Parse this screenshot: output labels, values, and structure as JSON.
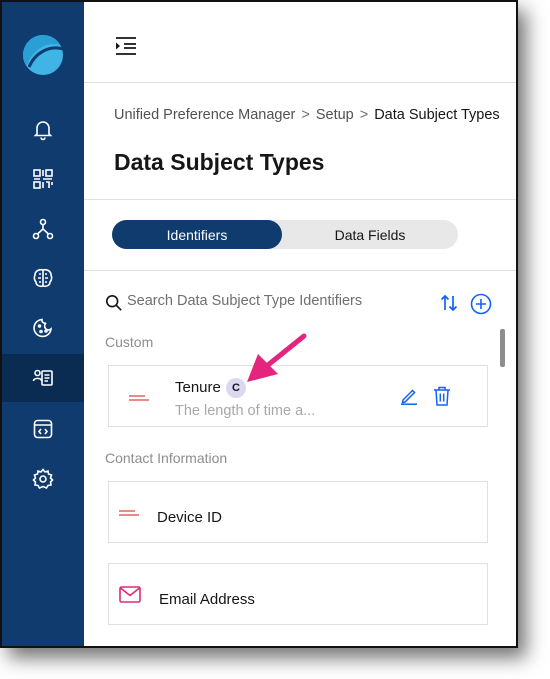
{
  "colors": {
    "sidebar": "#0f3b6e",
    "accent": "#0f62fe",
    "annotation": "#e5247d",
    "icon_red": "#e0443b",
    "icon_pink": "#e0287a"
  },
  "sidebar": {
    "logo": "app-logo",
    "items": [
      {
        "icon": "bell-icon",
        "name": "notifications"
      },
      {
        "icon": "qr-code-icon",
        "name": "data-discovery"
      },
      {
        "icon": "network-icon",
        "name": "data-mapping"
      },
      {
        "icon": "brain-icon",
        "name": "intelligence"
      },
      {
        "icon": "cookie-icon",
        "name": "cookie-consent"
      },
      {
        "icon": "user-list-icon",
        "name": "preference-manager",
        "active": true
      },
      {
        "icon": "code-window-icon",
        "name": "developer"
      },
      {
        "icon": "settings-icon",
        "name": "settings"
      }
    ]
  },
  "topbar": {
    "menu_icon": "collapse-menu-icon"
  },
  "breadcrumb": [
    "Unified Preference Manager",
    "Setup",
    "Data Subject Types"
  ],
  "breadcrumb_sep": ">",
  "page_title": "Data Subject Types",
  "tabs": [
    {
      "label": "Identifiers",
      "selected": true
    },
    {
      "label": "Data Fields",
      "selected": false
    }
  ],
  "search": {
    "placeholder": "Search Data Subject Type Identifiers"
  },
  "sections": [
    {
      "title": "Custom",
      "items": [
        {
          "name": "Tenure",
          "badge": "C",
          "description": "The length of time a...",
          "icon": "text-field-icon"
        }
      ]
    },
    {
      "title": "Contact Information",
      "items": [
        {
          "name": "Device ID",
          "icon": "text-field-icon"
        },
        {
          "name": "Email Address",
          "icon": "email-icon"
        }
      ]
    }
  ]
}
